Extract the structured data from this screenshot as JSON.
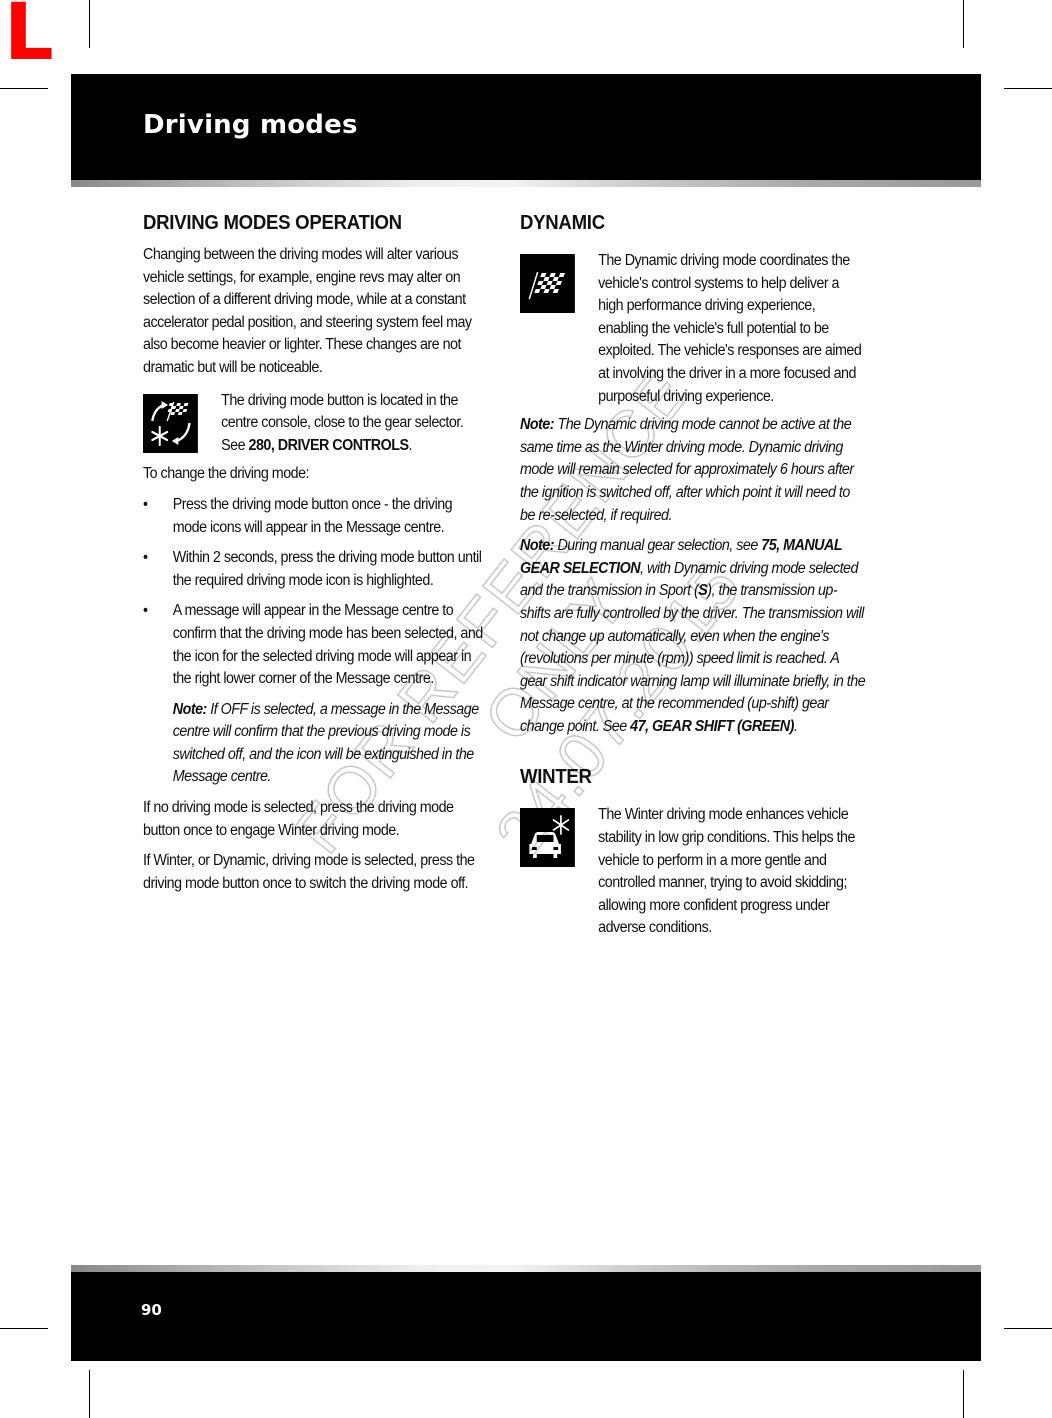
{
  "corner_marker": "L",
  "header": {
    "title": "Driving modes"
  },
  "footer": {
    "page_number": "90"
  },
  "watermark": {
    "line1": "FOR REFERENCE ONLY",
    "line2": "24.07.2015"
  },
  "left_column": {
    "heading": "DRIVING MODES OPERATION",
    "intro": "Changing between the driving modes will alter various vehicle settings, for example, engine revs may alter on selection of a different driving mode, while at a constant accelerator pedal position, and steering system feel may also become heavier or lighter. These changes are not dramatic but will be noticeable.",
    "button_info": {
      "icon": "driving-mode-button-icon",
      "text": "The driving mode button is located in the centre console, close to the gear selector. See ",
      "ref": "280, DRIVER CONTROLS",
      "suffix": "."
    },
    "steps_intro": "To change the driving mode:",
    "bullet_char": "•",
    "steps": [
      "Press the driving mode button once - the driving mode icons will appear in the Message centre.",
      "Within 2 seconds, press the driving mode button until the required driving mode icon is highlighted.",
      "A message will appear in the Message centre to confirm that the driving mode has been selected, and the icon for the selected driving mode will appear in the right lower corner of the Message centre."
    ],
    "note": {
      "label": "Note:",
      "text": " If OFF is selected, a message in the Message centre will confirm that the previous driving mode is switched off, and the icon will be extinguished in the Message centre."
    },
    "para_no_mode": "If no driving mode is selected, press the driving mode button once to engage Winter driving mode.",
    "para_switch_off": "If Winter, or Dynamic, driving mode is selected, press the driving mode button once to switch the driving mode off."
  },
  "right_column": {
    "dynamic": {
      "heading": "DYNAMIC",
      "icon": "checkered-flag-icon",
      "text": "The Dynamic driving mode coordinates the vehicle's control systems to help deliver a high performance driving experience, enabling the vehicle's full potential to be exploited. The vehicle's responses are aimed at involving the driver in a more focused and purposeful driving experience.",
      "note1": {
        "label": "Note:",
        "text": " The Dynamic driving mode cannot be active at the same time as the Winter driving mode. Dynamic driving mode will remain selected for approximately 6 hours after the ignition is switched off, after which point it will need to be re-selected, if required."
      },
      "note2": {
        "label": "Note:",
        "text_a": " During manual gear selection, see ",
        "ref_a": "75, MANUAL GEAR SELECTION",
        "text_b": ", with Dynamic driving mode selected and the transmission in Sport (",
        "sport_letter": "S",
        "text_c": "), the transmission up-shifts are fully controlled by the driver. The transmission will not change up automatically, even when the engine's (revolutions per minute (rpm)) speed limit is reached. A gear shift indicator warning lamp will illuminate briefly, in the Message centre, at the recommended (up-shift) gear change point. See ",
        "ref_b": "47, GEAR SHIFT (GREEN)",
        "text_d": "."
      }
    },
    "winter": {
      "heading": "WINTER",
      "icon": "winter-car-snowflake-icon",
      "text": "The Winter driving mode enhances vehicle stability in low grip conditions. This helps the vehicle to perform in a more gentle and controlled manner, trying to avoid skidding; allowing more confident progress under adverse conditions."
    }
  }
}
